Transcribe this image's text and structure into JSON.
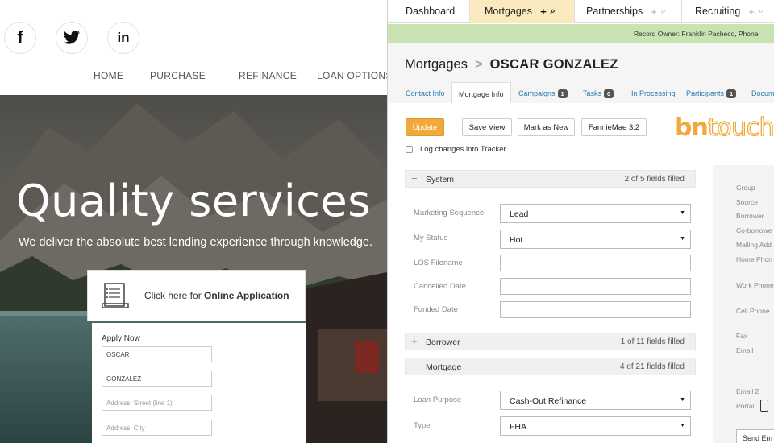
{
  "website": {
    "social": [
      {
        "name": "facebook",
        "glyph": "f"
      },
      {
        "name": "twitter",
        "glyph": ""
      },
      {
        "name": "linkedin",
        "glyph": "in"
      }
    ],
    "nav": [
      "HOME",
      "PURCHASE",
      "REFINANCE",
      "LOAN OPTIONS"
    ],
    "hero_title": "Quality services",
    "hero_subtitle": "We deliver the absolute best lending experience through knowledge.",
    "application_card": {
      "prefix": "Click here for ",
      "emphasis": "Online Application"
    },
    "apply_form": {
      "label": "Apply Now",
      "first_name": "OSCAR",
      "last_name": "GONZALEZ",
      "street_placeholder": "Address: Street (line 1)",
      "city_placeholder": "Address: City"
    }
  },
  "crm": {
    "top_tabs": [
      {
        "label": "Dashboard",
        "active": false
      },
      {
        "label": "Mortgages",
        "active": true
      },
      {
        "label": "Partnerships",
        "active": false
      },
      {
        "label": "Recruiting",
        "active": false
      }
    ],
    "record_owner": "Record Owner:  Franklin Pacheco,   Phone:",
    "breadcrumb": {
      "section": "Mortgages",
      "separator": ">",
      "record": "OSCAR GONZALEZ"
    },
    "sub_tabs": [
      {
        "label": "Contact Info",
        "count": null
      },
      {
        "label": "Mortgage Info",
        "count": null,
        "active": true
      },
      {
        "label": "Campaigns",
        "count": "1"
      },
      {
        "label": "Tasks",
        "count": "0"
      },
      {
        "label": "In Processing",
        "count": null
      },
      {
        "label": "Participants",
        "count": "1"
      },
      {
        "label": "Docum",
        "count": null
      }
    ],
    "buttons": {
      "update": "Update",
      "save_view": "Save View",
      "mark_as_new": "Mark as New",
      "fanniemae": "FannieMae 3.2"
    },
    "logo": {
      "part1": "bn",
      "part2": "touch",
      "color1": "#f0a93a",
      "color2": "#f0a93a"
    },
    "log_changes": "Log changes into Tracker",
    "sections": {
      "system": {
        "glyph": "−",
        "title": "System",
        "count": "2 of 5 fields filled"
      },
      "borrower": {
        "glyph": "+",
        "title": "Borrower",
        "count": "1 of 11 fields filled"
      },
      "mortgage": {
        "glyph": "−",
        "title": "Mortgage",
        "count": "4 of 21 fields filled"
      }
    },
    "system_fields": {
      "marketing_sequence": {
        "label": "Marketing Sequence",
        "value": "Lead"
      },
      "my_status": {
        "label": "My Status",
        "value": "Hot"
      },
      "los_filename": {
        "label": "LOS Filename",
        "value": ""
      },
      "cancelled_date": {
        "label": "Cancelled Date",
        "value": ""
      },
      "funded_date": {
        "label": "Funded Date",
        "value": ""
      }
    },
    "mortgage_fields": {
      "loan_purpose": {
        "label": "Loan Purpose",
        "value": "Cash-Out Refinance"
      },
      "type": {
        "label": "Type",
        "value": "FHA"
      }
    },
    "side_panel": [
      "Group",
      "Source",
      "Borrower",
      "Co-borrowe",
      "Mailing Add",
      "Home Phon",
      "Work Phone",
      "Cell Phone",
      "Fax",
      "Email",
      "Email 2",
      "Portal"
    ],
    "send_button": "Send Em"
  }
}
